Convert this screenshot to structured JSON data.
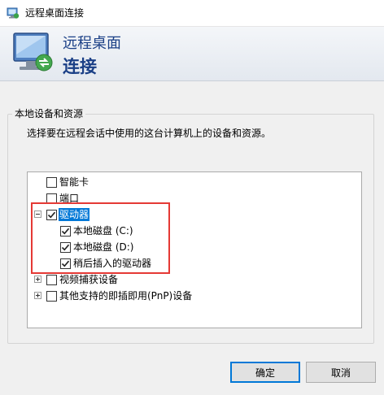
{
  "window": {
    "title": "远程桌面连接"
  },
  "header": {
    "line1": "远程桌面",
    "line2": "连接"
  },
  "group": {
    "legend": "本地设备和资源",
    "instruction": "选择要在远程会话中使用的这台计算机上的设备和资源。"
  },
  "tree": {
    "items": [
      {
        "label": "智能卡",
        "checked": false,
        "expander": "none",
        "selected": false
      },
      {
        "label": "端口",
        "checked": false,
        "expander": "none",
        "selected": false
      },
      {
        "label": "驱动器",
        "checked": true,
        "expander": "minus",
        "selected": true
      },
      {
        "label": "本地磁盘 (C:)",
        "checked": true,
        "expander": "none",
        "selected": false
      },
      {
        "label": "本地磁盘 (D:)",
        "checked": true,
        "expander": "none",
        "selected": false
      },
      {
        "label": "稍后插入的驱动器",
        "checked": true,
        "expander": "none",
        "selected": false
      },
      {
        "label": "视频捕获设备",
        "checked": false,
        "expander": "plus",
        "selected": false
      },
      {
        "label": "其他支持的即插即用(PnP)设备",
        "checked": false,
        "expander": "plus",
        "selected": false
      }
    ]
  },
  "buttons": {
    "ok": "确定",
    "cancel": "取消"
  },
  "colors": {
    "accent": "#0078d7",
    "highlight_box": "#e53935",
    "header_text": "#1a3f86"
  }
}
